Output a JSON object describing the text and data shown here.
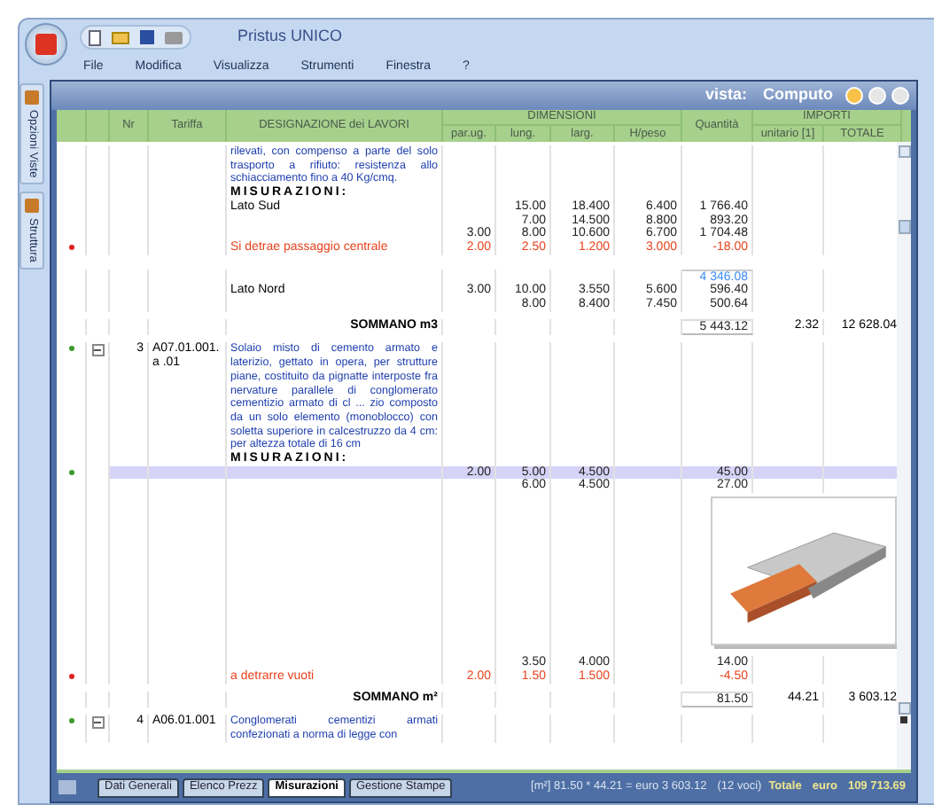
{
  "window": {
    "title": "Pristus UNICO"
  },
  "menu": [
    "File",
    "Modifica",
    "Visualizza",
    "Strumenti",
    "Finestra",
    "?"
  ],
  "side_tabs": [
    "Opzioni Viste",
    "Struttura"
  ],
  "view": {
    "label": "vista:",
    "name": "Computo"
  },
  "columns": {
    "nr": "Nr",
    "tariffa": "Tariffa",
    "designazione": "DESIGNAZIONE dei LAVORI",
    "dimensioni": "DIMENSIONI",
    "par": "par.ug.",
    "lung": "lung.",
    "larg": "larg.",
    "h": "H/peso",
    "quantita": "Quantità",
    "importi": "IMPORTI",
    "unitario": "unitario [1]",
    "totale": "TOTALE"
  },
  "rows": [
    {
      "kind": "description",
      "text": "rilevati, con compenso a parte del solo trasporto a rifiuto: resistenza allo schiacciamento fino a 40 Kg/cmq."
    },
    {
      "kind": "heading",
      "text": "MISURAZIONI:"
    },
    {
      "kind": "measure",
      "text": "Lato Sud",
      "lung": "15.00",
      "larg": "18.400",
      "h": "6.400",
      "qty": "1 766.40"
    },
    {
      "kind": "measure",
      "lung": "7.00",
      "larg": "14.500",
      "h": "8.800",
      "qty": "893.20"
    },
    {
      "kind": "measure",
      "par": "3.00",
      "lung": "8.00",
      "larg": "10.600",
      "h": "6.700",
      "qty": "1 704.48"
    },
    {
      "kind": "deduction",
      "color": "#e02020",
      "text": "Si detrae passaggio centrale",
      "par": "2.00",
      "lung": "2.50",
      "larg": "1.200",
      "h": "3.000",
      "qty": "-18.00"
    },
    {
      "kind": "partial",
      "qty": "4 346.08"
    },
    {
      "kind": "measure",
      "text": "Lato Nord",
      "par": "3.00",
      "lung": "10.00",
      "larg": "3.550",
      "h": "5.600",
      "qty": "596.40"
    },
    {
      "kind": "measure",
      "lung": "8.00",
      "larg": "8.400",
      "h": "7.450",
      "qty": "500.64"
    },
    {
      "kind": "total",
      "text": "SOMMANO m3",
      "qty": "5 443.12",
      "unit": "2.32",
      "total": "12 628.04"
    },
    {
      "kind": "item",
      "color": "#3c9a2a",
      "expanded": true,
      "nr": "3",
      "tariffa": "A07.01.001.a .01",
      "text": "Solaio misto di cemento armato e laterizio, gettato in opera, per strutture piane, costituito da pignatte interposte fra nervature parallele di conglomerato cementizio armato di cl ... zio composto da un solo elemento (monoblocco) con soletta superiore in calcestruzzo da 4 cm: per altezza totale di 16 cm"
    },
    {
      "kind": "heading",
      "text": "MISURAZIONI:"
    },
    {
      "kind": "measure",
      "selected": true,
      "color": "#3c9a2a",
      "par": "2.00",
      "lung": "5.00",
      "larg": "4.500",
      "qty": "45.00"
    },
    {
      "kind": "measure",
      "selected": false,
      "lung": "6.00",
      "larg": "4.500",
      "qty": "27.00"
    },
    {
      "kind": "picture"
    },
    {
      "kind": "measure",
      "lung": "3.50",
      "larg": "4.000",
      "qty": "14.00"
    },
    {
      "kind": "deduction",
      "color": "#e02020",
      "text": "a detrarre vuoti",
      "par": "2.00",
      "lung": "1.50",
      "larg": "1.500",
      "qty": "-4.50"
    },
    {
      "kind": "total",
      "text": "SOMMANO m²",
      "qty": "81.50",
      "unit": "44.21",
      "total": "3 603.12"
    },
    {
      "kind": "item",
      "color": "#3c9a2a",
      "expanded": true,
      "nr": "4",
      "tariffa": "A06.01.001",
      "text": "Conglomerati cementizi armati confezionati a norma di legge con"
    }
  ],
  "bottom_tabs": [
    {
      "label": "Dati Generali",
      "selected": false
    },
    {
      "label": "Elenco Prezz",
      "selected": false
    },
    {
      "label": "Misurazioni",
      "selected": true
    },
    {
      "label": "Gestione Stampe",
      "selected": false
    }
  ],
  "status": {
    "formula": "[m²] 81.50 * 44.21 = euro 3 603.12",
    "count": "(12 voci)",
    "total_label": "Totale",
    "currency": "euro",
    "total": "109 713.69"
  }
}
